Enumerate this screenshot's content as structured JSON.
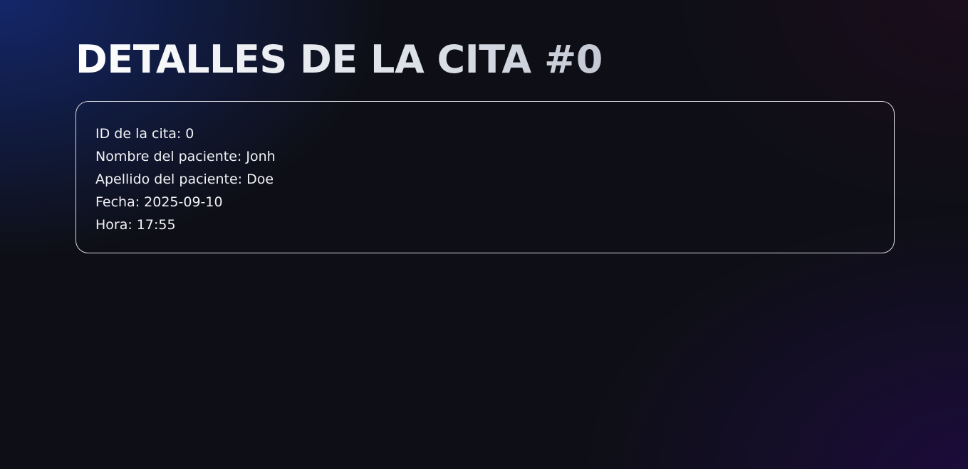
{
  "page": {
    "title": "DETALLES DE LA CITA #0"
  },
  "details": {
    "id": "ID de la cita: 0",
    "first_name": "Nombre del paciente: Jonh",
    "last_name": "Apellido del paciente: Doe",
    "date": "Fecha: 2025-09-10",
    "time": "Hora: 17:55"
  },
  "colors": {
    "background": "#0e0f16",
    "card_border": "#d8d8e0",
    "text": "#ffffff"
  }
}
